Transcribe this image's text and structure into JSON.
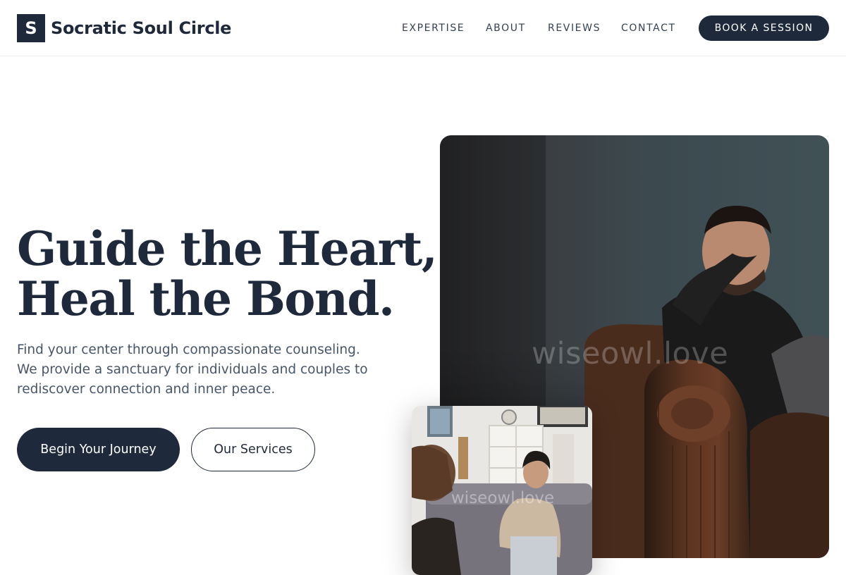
{
  "header": {
    "logo_letter": "S",
    "brand": "Socratic Soul Circle",
    "nav": [
      "EXPERTISE",
      "ABOUT",
      "REVIEWS",
      "CONTACT"
    ],
    "cta": "BOOK A SESSION"
  },
  "hero": {
    "title_line1": "Guide the Heart,",
    "title_line2": "Heal the Bond.",
    "text_line1": "Find your center through compassionate counseling.",
    "text_line2": "We provide a sanctuary for individuals and couples to",
    "text_line3": "rediscover connection and inner peace.",
    "primary_button": "Begin Your Journey",
    "secondary_button": "Our Services"
  },
  "images": {
    "main_watermark": "wiseowl.love",
    "small_watermark": "wiseowl.love"
  },
  "colors": {
    "primary": "#1e293b",
    "text_muted": "#475569",
    "background": "#ffffff"
  }
}
